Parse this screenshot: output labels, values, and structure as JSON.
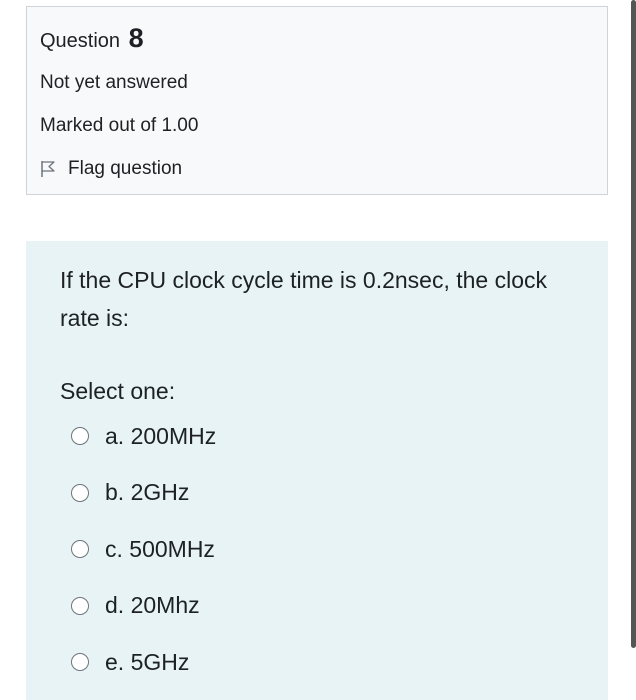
{
  "question_info": {
    "label": "Question",
    "number": "8",
    "state": "Not yet answered",
    "grade": "Marked out of 1.00",
    "flag": {
      "icon": "flag-outline-icon",
      "label": "Flag question"
    }
  },
  "question": {
    "text": "If the CPU clock cycle time is 0.2nsec, the clock rate is:",
    "prompt": "Select one:",
    "answers": [
      {
        "label": "a. 200MHz",
        "selected": false
      },
      {
        "label": "b. 2GHz",
        "selected": false
      },
      {
        "label": "c. 500MHz",
        "selected": false
      },
      {
        "label": "d. 20Mhz",
        "selected": false
      },
      {
        "label": "e. 5GHz",
        "selected": false
      }
    ]
  },
  "colors": {
    "info_background": "#f8f9fa",
    "info_border": "#cfd4da",
    "content_background": "#e7f3f5",
    "text": "#1d2125",
    "radio_border": "#6c757d"
  }
}
